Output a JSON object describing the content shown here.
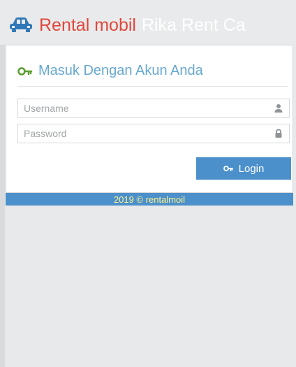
{
  "header": {
    "title_main": "Rental mobil",
    "title_subtitle": "Rika Rent Ca",
    "icon": "car-icon"
  },
  "login_panel": {
    "title": "Masuk Dengan Akun Anda",
    "title_icon": "key-icon",
    "username": {
      "value": "",
      "placeholder": "Username",
      "icon": "user-icon"
    },
    "password": {
      "value": "",
      "placeholder": "Password",
      "icon": "lock-icon"
    },
    "button": {
      "label": "Login",
      "icon": "key-icon"
    }
  },
  "footer": {
    "text": "2019 © rentalmoil"
  },
  "colors": {
    "brand_red": "#e0473c",
    "title_blue": "#67a8cf",
    "button_blue": "#4b90cb",
    "footer_text": "#fff38d",
    "background": "#e8e9ea"
  }
}
